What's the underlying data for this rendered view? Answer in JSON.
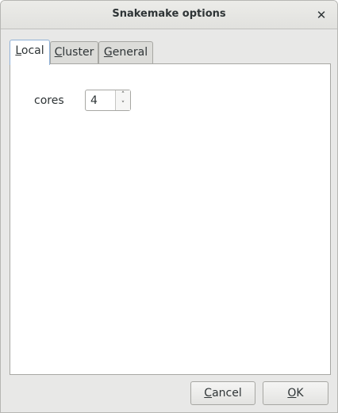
{
  "window": {
    "title": "Snakemake options",
    "close_glyph": "✕"
  },
  "tabs": [
    {
      "mnemonic": "L",
      "rest": "ocal",
      "active": true
    },
    {
      "mnemonic": "C",
      "rest": "luster",
      "active": false
    },
    {
      "mnemonic": "G",
      "rest": "eneral",
      "active": false
    }
  ],
  "local": {
    "cores_label": "cores",
    "cores_value": "4",
    "spin_up_glyph": "˄",
    "spin_down_glyph": "˅"
  },
  "buttons": {
    "cancel": {
      "mnemonic": "C",
      "rest": "ancel"
    },
    "ok": {
      "mnemonic": "O",
      "rest": "K"
    }
  },
  "icons": {
    "close": "close-icon",
    "spin_up": "chevron-up-icon",
    "spin_down": "chevron-down-icon"
  }
}
